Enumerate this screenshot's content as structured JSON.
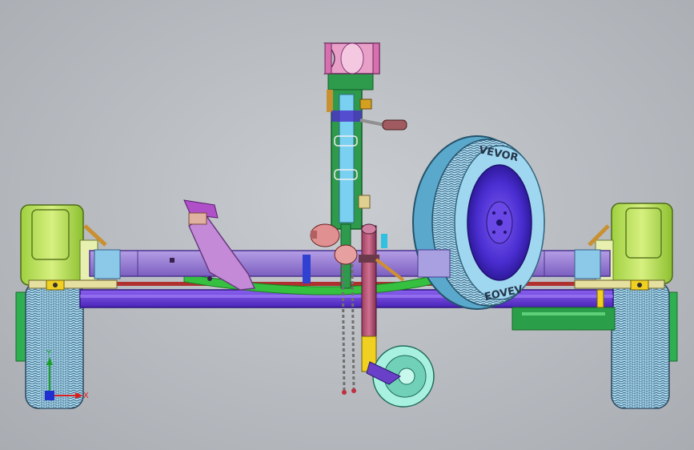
{
  "window": {
    "title": ""
  },
  "model": {
    "name": "",
    "components": [
      "frame-axle",
      "left-wheel",
      "right-wheel",
      "left-fender",
      "right-fender",
      "winch-post",
      "winch-roller",
      "winch-handle",
      "jockey-wheel",
      "safety-chains",
      "spare-tire",
      "trailer-coupler",
      "tilt-bracket"
    ]
  },
  "spare_tire": {
    "sidewall_text_top": "VEVOR",
    "sidewall_text_bottom": "EOVEV"
  },
  "triad": {
    "x_label": "X",
    "y_label": "Y"
  },
  "colors": {
    "background": "#bfc3c7",
    "frame": "#9b7fd0",
    "frame_dark": "#6d4fb0",
    "axle": "#6a3ed8",
    "fender": "#b8e05a",
    "tire_body": "#9fd6f0",
    "rim": "#5b3bd6",
    "winch_post": "#3fa65a",
    "roller": "#e8a0c8",
    "jockey_post": "#f0d020",
    "bracket": "#c48ad8",
    "leaf_spring": "#3ec03e"
  }
}
